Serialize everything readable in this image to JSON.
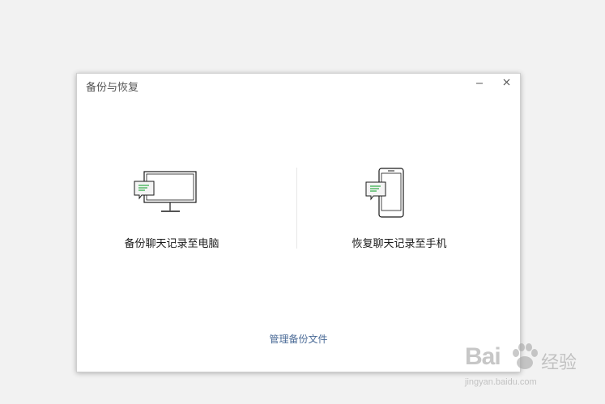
{
  "window": {
    "title": "备份与恢复",
    "minimize_glyph": "–",
    "close_glyph": "×"
  },
  "options": [
    {
      "label": "备份聊天记录至电脑",
      "icon": "monitor-chat-icon"
    },
    {
      "label": "恢复聊天记录至手机",
      "icon": "phone-chat-icon"
    }
  ],
  "footer": {
    "manage_link": "管理备份文件"
  },
  "watermark": {
    "brand_left": "Bai",
    "brand_right": "经验",
    "url": "jingyan.baidu.com"
  },
  "colors": {
    "accent_green": "#2bab43",
    "link_blue": "#4a6a96",
    "background": "#f2f2f2"
  }
}
